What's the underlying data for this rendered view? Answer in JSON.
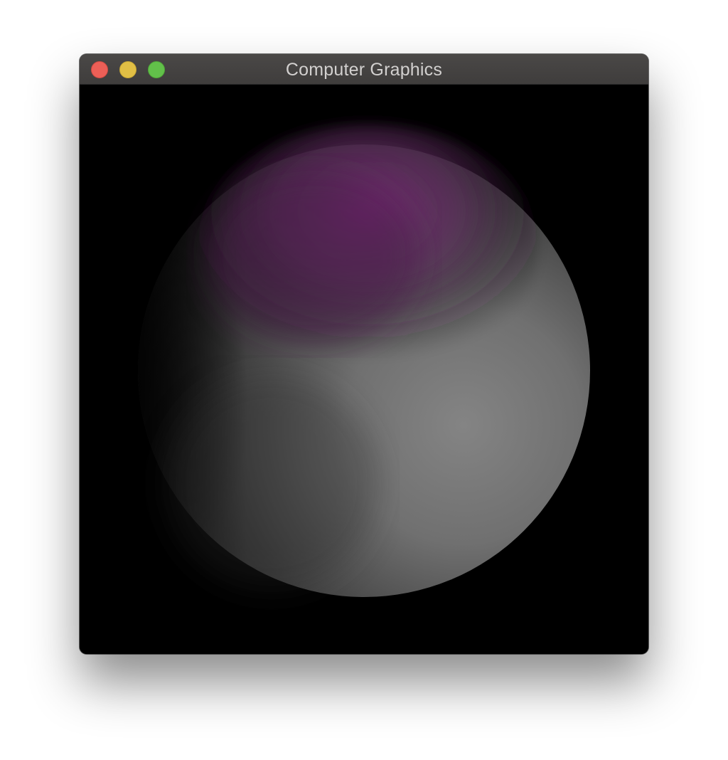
{
  "window": {
    "title": "Computer Graphics",
    "controls": {
      "close_icon": "close-icon",
      "minimize_icon": "minimize-icon",
      "zoom_icon": "zoom-icon"
    }
  },
  "scene": {
    "background_color": "#000000",
    "sphere_color": "#8a8a8a",
    "highlight_color": "#7a2a78"
  }
}
